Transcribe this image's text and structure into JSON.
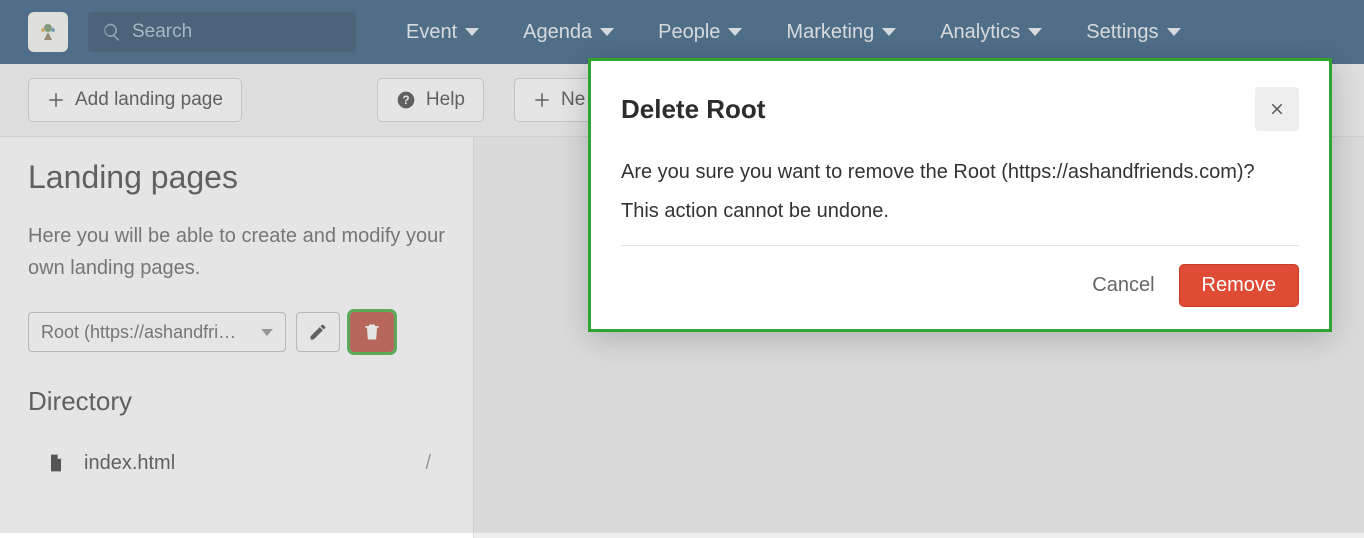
{
  "nav": {
    "search_placeholder": "Search",
    "items": [
      "Event",
      "Agenda",
      "People",
      "Marketing",
      "Analytics",
      "Settings"
    ]
  },
  "toolbar": {
    "add_landing_page": "Add landing page",
    "help": "Help",
    "new": "Ne"
  },
  "sidebar": {
    "title": "Landing pages",
    "intro": "Here you will be able to create and modify your own landing pages.",
    "root_select_label": "Root (https://ashandfri…",
    "directory_heading": "Directory",
    "directory_file": "index.html",
    "directory_slash": "/"
  },
  "modal": {
    "title": "Delete Root",
    "line1": "Are you sure you want to remove the Root (https://ashandfriends.com)?",
    "line2": "This action cannot be undone.",
    "cancel": "Cancel",
    "remove": "Remove"
  }
}
